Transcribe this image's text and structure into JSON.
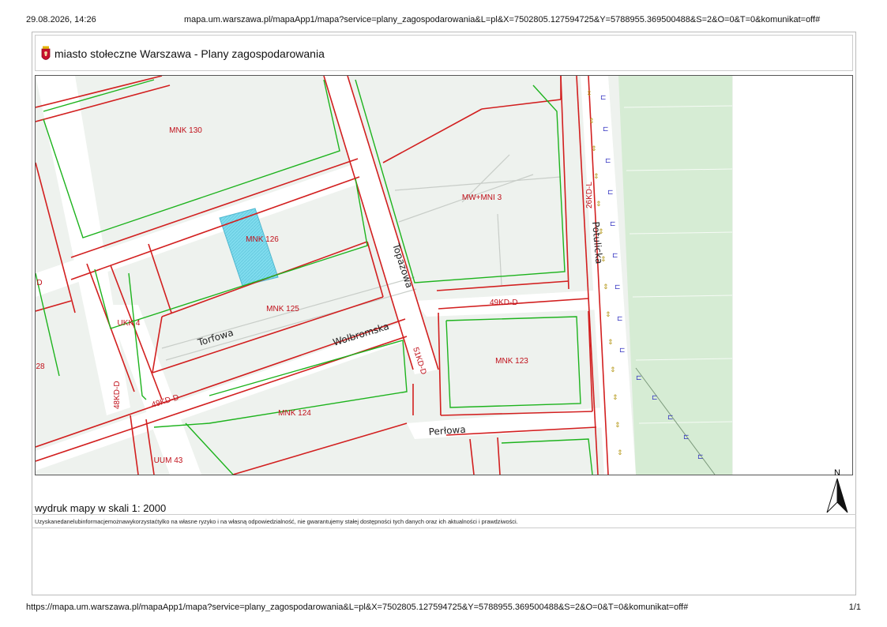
{
  "print_header": {
    "datetime": "29.08.2026, 14:26",
    "url": "mapa.um.warszawa.pl/mapaApp1/mapa?service=plany_zagospodarowania&L=pl&X=7502805.127594725&Y=5788955.369500488&S=2&O=0&T=0&komunikat=off#"
  },
  "app": {
    "title": "miasto stołeczne Warszawa - Plany zagospodarowania",
    "crest_icon": "warsaw-crest-icon"
  },
  "map": {
    "zones": [
      {
        "id": "mnk130",
        "label": "MNK 130"
      },
      {
        "id": "mnk126",
        "label": "MNK 126"
      },
      {
        "id": "mnk125",
        "label": "MNK 125"
      },
      {
        "id": "ukk4",
        "label": "UKK 4"
      },
      {
        "id": "mwmni3",
        "label": "MW+MNI 3"
      },
      {
        "id": "mnk123",
        "label": "MNK 123"
      },
      {
        "id": "mnk124",
        "label": "MNK 124"
      },
      {
        "id": "uum43",
        "label": "UUM 43"
      },
      {
        "id": "partial28",
        "label": "28"
      },
      {
        "id": "partialD",
        "label": "D"
      }
    ],
    "roads": [
      {
        "id": "torfowa",
        "label": "Torfowa"
      },
      {
        "id": "wolbromska",
        "label": "Wolbromska"
      },
      {
        "id": "topazowa",
        "label": "Topazowa"
      },
      {
        "id": "perlowa",
        "label": "Perłowa"
      },
      {
        "id": "potulicka",
        "label": "Potulicka"
      }
    ],
    "road_codes": [
      {
        "id": "kd49a",
        "label": "49KD-D"
      },
      {
        "id": "kd49b",
        "label": "49KD-D"
      },
      {
        "id": "kd51",
        "label": "51KD-D"
      },
      {
        "id": "kd48",
        "label": "48KD-D"
      },
      {
        "id": "kd26",
        "label": "26KD-L"
      }
    ],
    "colors": {
      "zone_fill": "#eef2ee",
      "boundary": "#d21f1f",
      "building_line": "#1db31d",
      "road": "#ffffff",
      "green_area": "#d6ecd4",
      "selected_parcel": "#7fdcee",
      "label": "#c0101a"
    }
  },
  "scale": {
    "text": "wydruk mapy w skali 1: 2000"
  },
  "north": {
    "label": "N",
    "icon": "north-arrow-icon"
  },
  "disclaimer": "Uzyskanedanelubinformacjemożnawykorzystaćtylko na własne ryzyko i na własną odpowiedzialność, nie gwarantujemy stałej dostępności tych danych oraz ich aktualności i prawdziwości.",
  "print_footer": {
    "url": "https://mapa.um.warszawa.pl/mapaApp1/mapa?service=plany_zagospodarowania&L=pl&X=7502805.127594725&Y=5788955.369500488&S=2&O=0&T=0&komunikat=off#",
    "page": "1/1"
  }
}
